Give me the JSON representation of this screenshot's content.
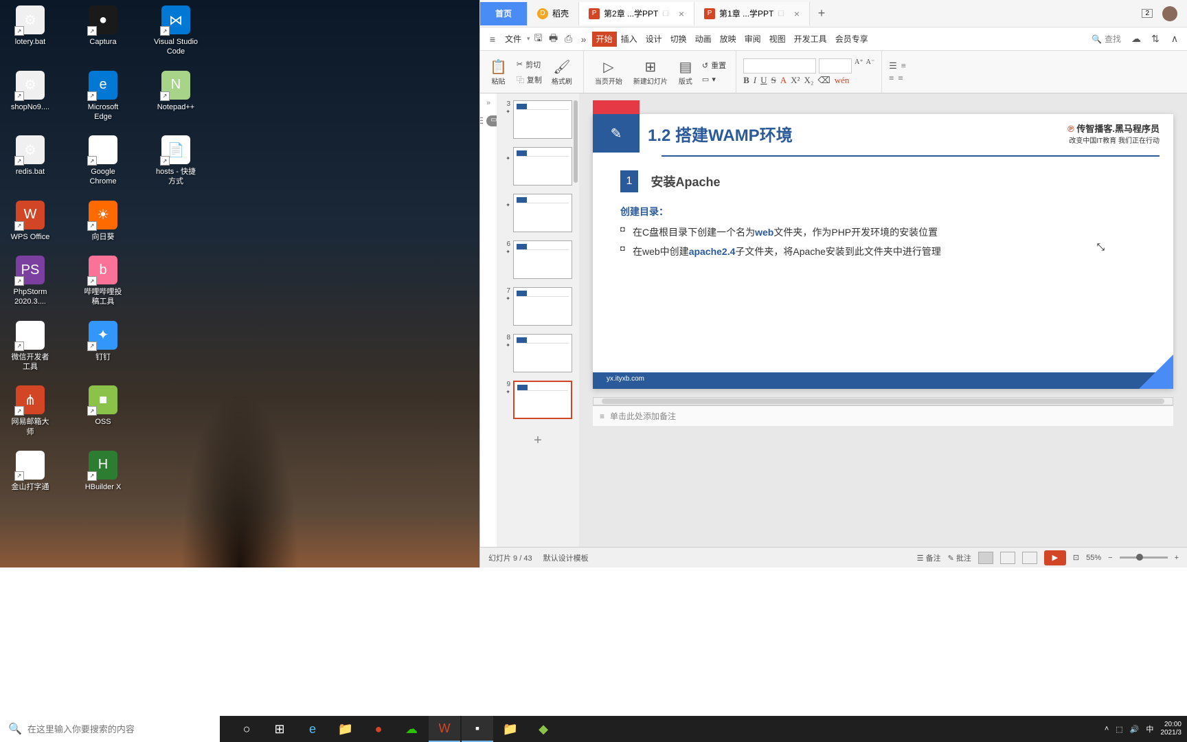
{
  "desktop": {
    "icons": [
      [
        {
          "name": "lotery-bat",
          "label": "lotery.bat",
          "bg": "#f0f0f0",
          "glyph": "⚙",
          "shortcut": true
        },
        {
          "name": "captura",
          "label": "Captura",
          "bg": "#1a1a1a",
          "glyph": "●",
          "shortcut": true
        },
        {
          "name": "vscode",
          "label": "Visual Studio Code",
          "bg": "#0078d4",
          "glyph": "⋈",
          "shortcut": true
        }
      ],
      [
        {
          "name": "shopno9",
          "label": "shopNo9....",
          "bg": "#f0f0f0",
          "glyph": "⚙",
          "shortcut": true
        },
        {
          "name": "edge",
          "label": "Microsoft Edge",
          "bg": "#0078d4",
          "glyph": "e",
          "shortcut": true
        },
        {
          "name": "notepadpp",
          "label": "Notepad++",
          "bg": "#a8d48a",
          "glyph": "N",
          "shortcut": true
        }
      ],
      [
        {
          "name": "redis-bat",
          "label": "redis.bat",
          "bg": "#f0f0f0",
          "glyph": "⚙",
          "shortcut": true
        },
        {
          "name": "chrome",
          "label": "Google Chrome",
          "bg": "#fff",
          "glyph": "◉",
          "shortcut": true
        },
        {
          "name": "hosts",
          "label": "hosts - 快捷方式",
          "bg": "#fff",
          "glyph": "📄",
          "shortcut": true
        }
      ],
      [
        {
          "name": "wps-office",
          "label": "WPS Office",
          "bg": "#d24625",
          "glyph": "W",
          "shortcut": true
        },
        {
          "name": "xiangrikui",
          "label": "向日葵",
          "bg": "#ff6a00",
          "glyph": "☀",
          "shortcut": true
        }
      ],
      [
        {
          "name": "phpstorm",
          "label": "PhpStorm 2020.3....",
          "bg": "#7b3fa0",
          "glyph": "PS",
          "shortcut": true
        },
        {
          "name": "bilibili-tool",
          "label": "哔哩哔哩投稿工具",
          "bg": "#fb7299",
          "glyph": "b",
          "shortcut": true
        }
      ],
      [
        {
          "name": "wechat-dev",
          "label": "微信开发者工具",
          "bg": "#fff",
          "glyph": "▶",
          "shortcut": true
        },
        {
          "name": "dingtalk",
          "label": "钉钉",
          "bg": "#3296fa",
          "glyph": "✦",
          "shortcut": true
        }
      ],
      [
        {
          "name": "netease-mail",
          "label": "网易邮箱大师",
          "bg": "#d24625",
          "glyph": "⋔",
          "shortcut": true
        },
        {
          "name": "oss",
          "label": "OSS",
          "bg": "#8bc34a",
          "glyph": "■",
          "shortcut": true
        }
      ],
      [
        {
          "name": "jinshan",
          "label": "金山打字通",
          "bg": "#fff",
          "glyph": "✿",
          "shortcut": true
        },
        {
          "name": "hbuilderx",
          "label": "HBuilder X",
          "bg": "#2c7d32",
          "glyph": "H",
          "shortcut": true
        }
      ]
    ]
  },
  "taskbar": {
    "search_placeholder": "在这里输入你要搜索的内容",
    "ime": "中",
    "time": "20:00",
    "date": "2021/3"
  },
  "wps": {
    "tabs": {
      "home": "首页",
      "daoke": "稻壳",
      "doc1": "第2章 ...学PPT",
      "doc2": "第1章 ...学PPT"
    },
    "title_badge": "2",
    "menu": {
      "file": "文件",
      "items": [
        "开始",
        "插入",
        "设计",
        "切换",
        "动画",
        "放映",
        "审阅",
        "视图",
        "开发工具",
        "会员专享"
      ],
      "search": "查找"
    },
    "ribbon": {
      "paste": "粘贴",
      "cut": "剪切",
      "copy": "复制",
      "format_painter": "格式刷",
      "page_start": "当页开始",
      "new_slide": "新建幻灯片",
      "layout": "版式",
      "reset": "重置"
    },
    "thumbnails": [
      {
        "num": "3"
      },
      {
        "num": ""
      },
      {
        "num": ""
      },
      {
        "num": "6"
      },
      {
        "num": "7"
      },
      {
        "num": "8"
      },
      {
        "num": "9",
        "current": true
      }
    ],
    "slide": {
      "title": "1.2 搭建WAMP环境",
      "brand_name": "传智播客.黑马程序员",
      "brand_slogan": "改变中国IT教育 我们正在行动",
      "section_num": "1",
      "section_title": "安装Apache",
      "sub_title": "创建目录：",
      "bullet1_pre": "在C盘根目录下创建一个名为",
      "bullet1_hl": "web",
      "bullet1_post": "文件夹，作为PHP开发环境的安装位置",
      "bullet2_pre": "在web中创建",
      "bullet2_hl": "apache2.4",
      "bullet2_post": "子文件夹，将Apache安装到此文件夹中进行管理",
      "footer_url": "yx.ityxb.com"
    },
    "notes_placeholder": "单击此处添加备注",
    "status": {
      "slide_info": "幻灯片 9 / 43",
      "template": "默认设计模板",
      "notes": "备注",
      "comments": "批注",
      "zoom": "55%"
    }
  }
}
